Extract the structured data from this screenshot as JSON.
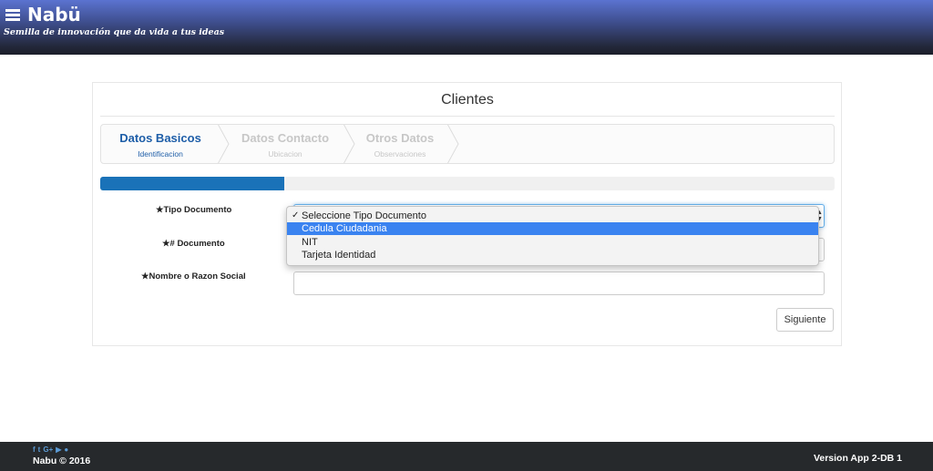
{
  "header": {
    "brand": "Nabü",
    "tagline": "Semilla de innovación que da vida a tus ideas"
  },
  "panel": {
    "title": "Clientes"
  },
  "steps": [
    {
      "title": "Datos Basicos",
      "subtitle": "Identificacion",
      "active": true
    },
    {
      "title": "Datos Contacto",
      "subtitle": "Ubicacion",
      "active": false
    },
    {
      "title": "Otros Datos",
      "subtitle": "Observaciones",
      "active": false
    }
  ],
  "progress": {
    "fraction": 0.25
  },
  "form": {
    "tipo_documento_label": "★Tipo Documento",
    "num_documento_label": "★# Documento",
    "nombre_label": "★Nombre o Razon Social",
    "nombre_value": "",
    "next_button": "Siguiente"
  },
  "dropdown": {
    "options": [
      {
        "label": "Seleccione Tipo Documento",
        "checked": true,
        "highlighted": false
      },
      {
        "label": "Cedula Ciudadania",
        "checked": false,
        "highlighted": true
      },
      {
        "label": "NIT",
        "checked": false,
        "highlighted": false
      },
      {
        "label": "Tarjeta Identidad",
        "checked": false,
        "highlighted": false
      }
    ],
    "check_mark": "✓"
  },
  "footer": {
    "social_icons": [
      "facebook-icon",
      "twitter-icon",
      "google-plus-icon",
      "youtube-icon",
      "github-icon"
    ],
    "social_glyphs": [
      "f",
      "t",
      "G+",
      "▶",
      "●"
    ],
    "copyright": "Nabu © 2016",
    "version": "Version App 2-DB 1"
  },
  "colors": {
    "accent": "#1a72b8",
    "step_active": "#1e5ea8",
    "highlight": "#3a83f0",
    "footer_bg": "#26292c"
  }
}
